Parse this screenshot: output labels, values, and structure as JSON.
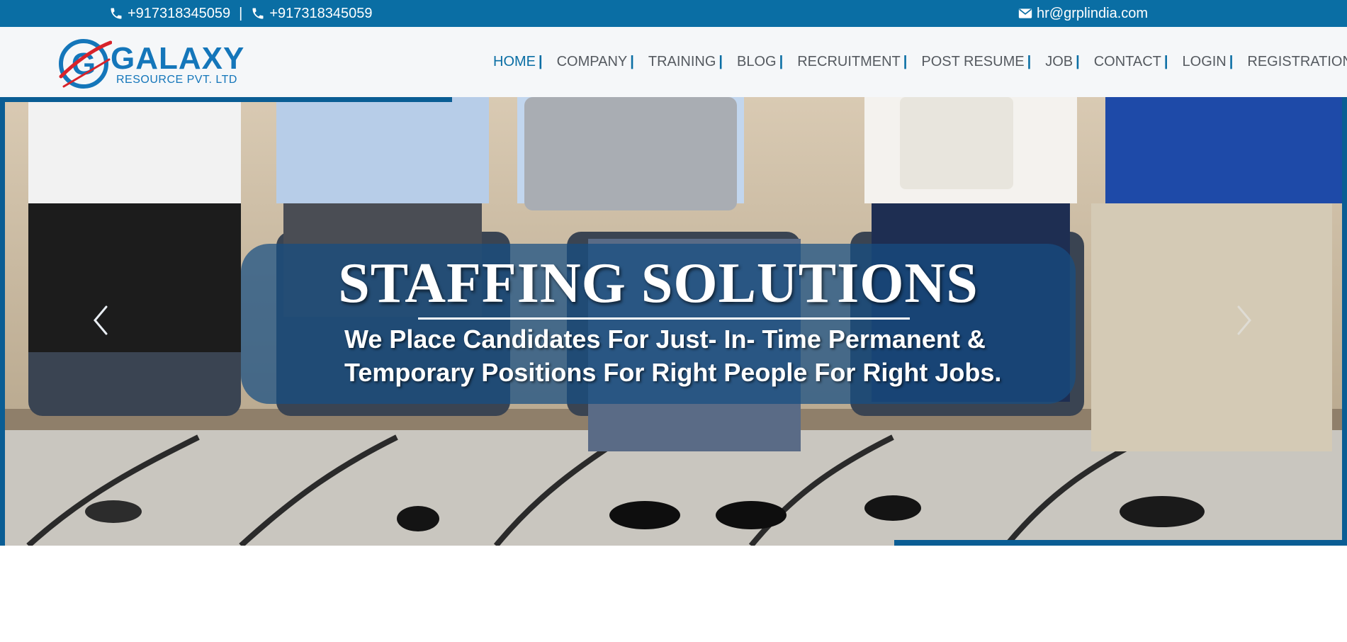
{
  "topbar": {
    "phone_1": "+917318345059",
    "separator": "|",
    "phone_2": "+917318345059",
    "email": "hr@grplindia.com",
    "icons": {
      "phone": "phone-icon",
      "email": "envelope-icon"
    }
  },
  "logo": {
    "word": "GALAXY",
    "sub": "RESOURCE PVT. LTD"
  },
  "nav": {
    "items": [
      {
        "label": "HOME",
        "bar": "|",
        "active": true
      },
      {
        "label": "COMPANY",
        "bar": "|"
      },
      {
        "label": "TRAINING",
        "bar": "|"
      },
      {
        "label": "BLOG",
        "bar": "|"
      },
      {
        "label": "RECRUITMENT",
        "bar": "|"
      },
      {
        "label": "POST RESUME",
        "bar": "|"
      },
      {
        "label": "JOB",
        "bar": "|"
      },
      {
        "label": "CONTACT",
        "bar": "|"
      },
      {
        "label": "LOGIN",
        "bar": "|"
      },
      {
        "label": "REGISTRATION",
        "bar": "|"
      }
    ]
  },
  "hero": {
    "title": "STAFFING SOLUTIONS",
    "line_1": "We Place Candidates For Just- In- Time Permanent &",
    "line_2": "Temporary Positions For Right People For Right Jobs.",
    "prev_icon": "chevron-left-icon",
    "next_icon": "chevron-right-icon"
  },
  "colors": {
    "brand_blue": "#0a6ea4",
    "frame_blue": "#0a5d94",
    "logo_red": "#d8232a",
    "nav_text": "#555a60",
    "header_bg": "#f5f7f9"
  }
}
